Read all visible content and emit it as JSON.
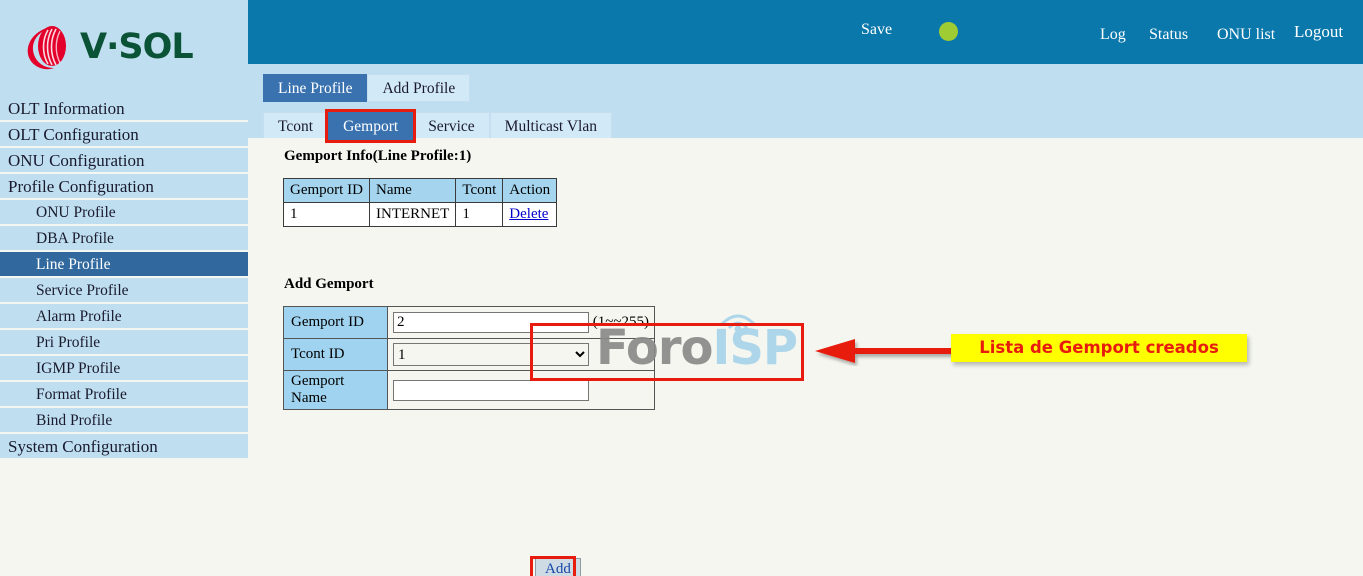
{
  "brand": {
    "name": "V·SOL",
    "logo_icon": "vsol-flame-logo",
    "text_color": "#0b5336",
    "mark_color": "#e3002b"
  },
  "header": {
    "save_label": "Save",
    "status_dot": {
      "icon": "status-indicator-circle",
      "color": "#9fcb33"
    },
    "links": [
      {
        "label": "Log"
      },
      {
        "label": "Status"
      },
      {
        "label": "ONU list"
      },
      {
        "label": "Logout"
      }
    ]
  },
  "sidebar": {
    "items": [
      {
        "label": "OLT Information",
        "sub": false,
        "active": false
      },
      {
        "label": "OLT Configuration",
        "sub": false,
        "active": false
      },
      {
        "label": "ONU Configuration",
        "sub": false,
        "active": false
      },
      {
        "label": "Profile Configuration",
        "sub": false,
        "active": false
      },
      {
        "label": "ONU Profile",
        "sub": true,
        "active": false
      },
      {
        "label": "DBA Profile",
        "sub": true,
        "active": false
      },
      {
        "label": "Line Profile",
        "sub": true,
        "active": true
      },
      {
        "label": "Service Profile",
        "sub": true,
        "active": false
      },
      {
        "label": "Alarm Profile",
        "sub": true,
        "active": false
      },
      {
        "label": "Pri Profile",
        "sub": true,
        "active": false
      },
      {
        "label": "IGMP Profile",
        "sub": true,
        "active": false
      },
      {
        "label": "Format Profile",
        "sub": true,
        "active": false
      },
      {
        "label": "Bind Profile",
        "sub": true,
        "active": false
      },
      {
        "label": "System Configuration",
        "sub": false,
        "active": false
      }
    ]
  },
  "tabs_primary": [
    {
      "label": "Line Profile",
      "active": true,
      "highlight": false
    },
    {
      "label": "Add Profile",
      "active": false,
      "highlight": false
    }
  ],
  "tabs_secondary": [
    {
      "label": "Tcont",
      "active": false,
      "highlight": false
    },
    {
      "label": "Gemport",
      "active": true,
      "highlight": true
    },
    {
      "label": "Service",
      "active": false,
      "highlight": false
    },
    {
      "label": "Multicast Vlan",
      "active": false,
      "highlight": false
    }
  ],
  "gemport_info": {
    "title": "Gemport Info(Line Profile:1)",
    "columns": [
      "Gemport ID",
      "Name",
      "Tcont",
      "Action"
    ],
    "rows": [
      {
        "gemport_id": "1",
        "name": "INTERNET",
        "tcont": "1",
        "action": "Delete"
      }
    ],
    "highlighted": true
  },
  "annotation": {
    "text": "Lista de Gemport creados",
    "text_color": "#e81c0e",
    "background": "#ffff00",
    "arrow_color": "#e81c0e",
    "arrow_direction": "left"
  },
  "watermark": {
    "part1": "Foro",
    "part2": "ISP",
    "part1_color": "#8a8a8a",
    "part2_color": "#a8d4ea",
    "icon": "antenna-tower-icon"
  },
  "add_gemport": {
    "title": "Add Gemport",
    "fields": [
      {
        "label": "Gemport ID",
        "type": "text",
        "value": "2",
        "placeholder": "",
        "hint": "(1~~255)"
      },
      {
        "label": "Tcont ID",
        "type": "select",
        "value": "1",
        "options": [
          "1"
        ],
        "hint": ""
      },
      {
        "label": "Gemport Name",
        "type": "text",
        "value": "",
        "placeholder": "",
        "hint": ""
      }
    ],
    "submit_label": "Add",
    "submit_highlighted": true
  },
  "colors": {
    "header_blue": "#0a78ab",
    "sidebar_blue": "#bfdff0",
    "active_blue": "#31699f",
    "tab_active": "#3a72b0",
    "content_bg": "#f4f6ef",
    "table_header": "#a5d5ee",
    "form_label": "#9fd3ef",
    "highlight_red": "#e81c0e"
  }
}
